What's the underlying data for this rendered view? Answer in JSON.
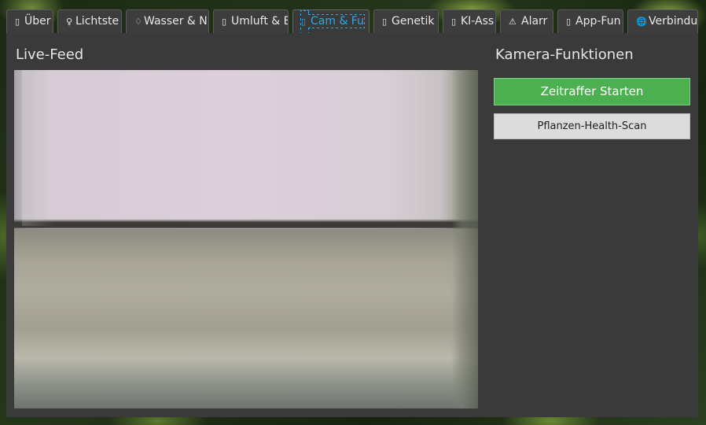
{
  "tabs": [
    {
      "icon": "chart-icon",
      "label": "Über"
    },
    {
      "icon": "bulb-icon",
      "label": "Lichtste"
    },
    {
      "icon": "droplet-icon",
      "label": "Wasser & N"
    },
    {
      "icon": "fan-icon",
      "label": "Umluft & E"
    },
    {
      "icon": "camera-icon",
      "label": "Cam & Fu",
      "active": true
    },
    {
      "icon": "dna-icon",
      "label": "Genetik"
    },
    {
      "icon": "robot-icon",
      "label": "KI-Ass"
    },
    {
      "icon": "warning-icon",
      "glyph": "⚠",
      "label": "Alarr"
    },
    {
      "icon": "phone-icon",
      "label": "App-Fun"
    },
    {
      "icon": "globe-icon",
      "glyph": "🌐",
      "label": "Verbindu"
    }
  ],
  "live_feed": {
    "title": "Live-Feed"
  },
  "camera_functions": {
    "title": "Kamera-Funktionen",
    "timelapse_button": "Zeitraffer Starten",
    "health_scan_button": "Pflanzen-Health-Scan"
  },
  "colors": {
    "active_tab": "#2ea8e6",
    "start_button": "#4caf50",
    "panel_background": "#3a3a3a"
  }
}
